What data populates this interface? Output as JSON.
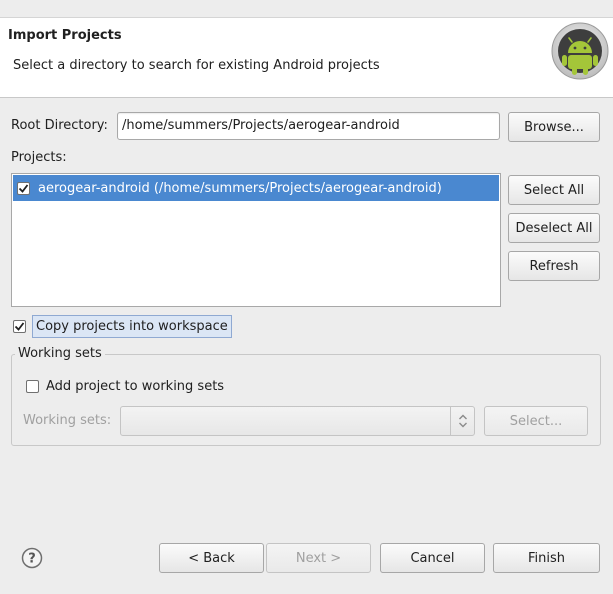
{
  "header": {
    "title": "Import Projects",
    "description": "Select a directory to search for existing Android projects",
    "logo_icon": "android-robot-icon"
  },
  "root_directory": {
    "label": "Root Directory:",
    "value": "/home/summers/Projects/aerogear-android",
    "browse_label": "Browse..."
  },
  "projects": {
    "label": "Projects:",
    "items": [
      {
        "checked": true,
        "label": "aerogear-android (/home/summers/Projects/aerogear-android)"
      }
    ],
    "select_all_label": "Select All",
    "deselect_all_label": "Deselect All",
    "refresh_label": "Refresh"
  },
  "copy_into_workspace": {
    "checked": true,
    "label": "Copy projects into workspace"
  },
  "working_sets": {
    "group_title": "Working sets",
    "add_checkbox": {
      "checked": false,
      "label": "Add project to working sets"
    },
    "field_label": "Working sets:",
    "combo_value": "",
    "select_label": "Select...",
    "enabled": false
  },
  "footer": {
    "help_icon": "help-question-icon",
    "back_label": "< Back",
    "next_label": "Next >",
    "cancel_label": "Cancel",
    "finish_label": "Finish"
  },
  "colors": {
    "selection": "#4a88d0",
    "dialog_bg": "#ededed",
    "banner_bg": "#ffffff",
    "android_green": "#a4c639"
  }
}
